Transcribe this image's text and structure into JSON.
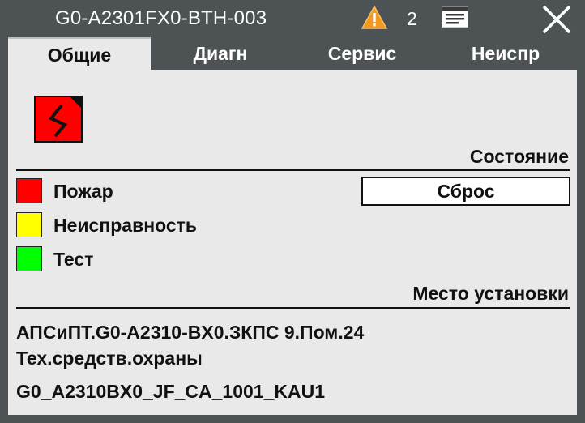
{
  "window": {
    "title": "G0-A2301FX0-BTH-003",
    "warning_icon": "warning-triangle-icon",
    "warning_count": "2",
    "document_icon": "document-icon",
    "close_icon": "close-icon"
  },
  "tabs": [
    {
      "label": "Общие",
      "active": true
    },
    {
      "label": "Диагн",
      "active": false
    },
    {
      "label": "Сервис",
      "active": false
    },
    {
      "label": "Неиспр",
      "active": false
    }
  ],
  "status": {
    "device_icon": "fire-detector-status-icon",
    "section_title": "Состояние",
    "reset_label": "Сброс",
    "legend": [
      {
        "label": "Пожар",
        "color": "#ff0000"
      },
      {
        "label": "Неисправность",
        "color": "#ffff00"
      },
      {
        "label": "Тест",
        "color": "#00ff00"
      }
    ]
  },
  "location": {
    "section_title": "Место установки",
    "line1": "АПСиПТ.G0-A2310-BX0.ЗКПС 9.Пом.24",
    "line2": "Тех.средств.охраны",
    "line3": "G0_A2310BX0_JF_CA_1001_KAU1"
  }
}
